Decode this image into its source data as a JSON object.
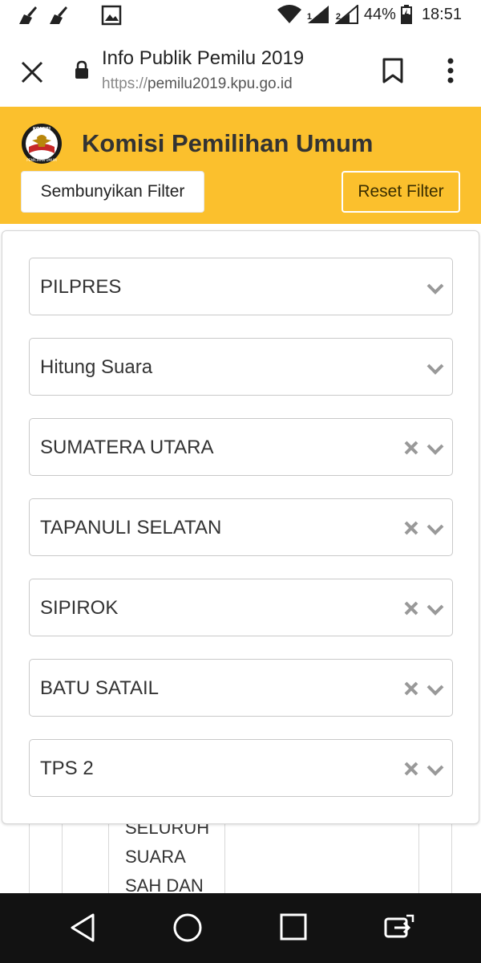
{
  "status_bar": {
    "battery": "44%",
    "time": "18:51",
    "sim1": "1",
    "sim2": "2"
  },
  "browser": {
    "title": "Info Publik Pemilu 2019",
    "url_scheme": "https://",
    "url_host": "pemilu2019.kpu.go.id"
  },
  "header": {
    "title": "Komisi Pemilihan Umum",
    "hide_filter_label": "Sembunyikan Filter",
    "reset_filter_label": "Reset Filter",
    "logo_text_top": "KOMISI",
    "logo_text_bottom": "PEMILIHAN UMUM",
    "background_color": "#fbc02d"
  },
  "filters": [
    {
      "value": "PILPRES",
      "clearable": false
    },
    {
      "value": "Hitung Suara",
      "clearable": false
    },
    {
      "value": "SUMATERA UTARA",
      "clearable": true
    },
    {
      "value": "TAPANULI SELATAN",
      "clearable": true
    },
    {
      "value": "SIPIROK",
      "clearable": true
    },
    {
      "value": "BATU SATAIL",
      "clearable": true
    },
    {
      "value": "TPS 2",
      "clearable": true
    }
  ],
  "background_table": {
    "lines": [
      "SELURUH",
      "SUARA",
      "SAH DAN"
    ]
  },
  "nav_bar": {
    "buttons": [
      "back-icon",
      "home-icon",
      "recents-icon",
      "rotate-icon"
    ]
  }
}
